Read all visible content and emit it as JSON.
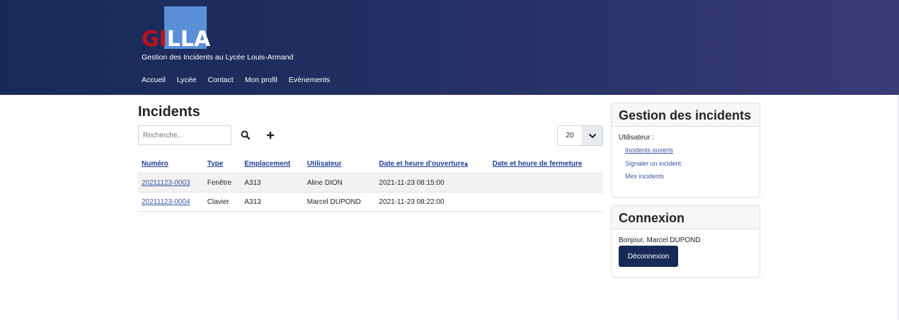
{
  "header": {
    "logo": {
      "part1": "GI",
      "part2": "LLA"
    },
    "subtitle": "Gestion des Incidents au Lycée Louis-Armand",
    "nav": [
      "Accueil",
      "Lycée",
      "Contact",
      "Mon profil",
      "Evènements"
    ]
  },
  "main": {
    "title": "Incidents",
    "search_placeholder": "Recherche...",
    "page_size": "20",
    "columns": [
      "Numéro",
      "Type",
      "Emplacement",
      "Utilisateur",
      "Date et heure d'ouverture▴",
      "Date et heure de fermeture"
    ],
    "rows": [
      {
        "numero": "20211123-0003",
        "type": "Fenêtre",
        "emplacement": "A313",
        "utilisateur": "Aline DION",
        "ouverture": "2021-11-23 08:15:00",
        "fermeture": ""
      },
      {
        "numero": "20211123-0004",
        "type": "Clavier",
        "emplacement": "A313",
        "utilisateur": "Marcel DUPOND",
        "ouverture": "2021-11-23 08:22:00",
        "fermeture": ""
      }
    ]
  },
  "sidebar": {
    "gestion": {
      "title": "Gestion des incidents",
      "label": "Utilisateur :",
      "links": [
        "Incidents ouverts",
        "Signaler un incident",
        "Mes incidents"
      ]
    },
    "connexion": {
      "title": "Connexion",
      "greeting": "Bonjour, Marcel DUPOND",
      "logout": "Déconnexion"
    }
  },
  "colors": {
    "header_start": "#172a57",
    "header_end": "#3a3a74",
    "logo_red": "#c0121a",
    "logo_blue": "#5b8fd8",
    "link": "#3a57a3"
  },
  "icons": {
    "search": "search-icon",
    "add": "plus-icon",
    "dropdown": "chevron-down-icon"
  }
}
